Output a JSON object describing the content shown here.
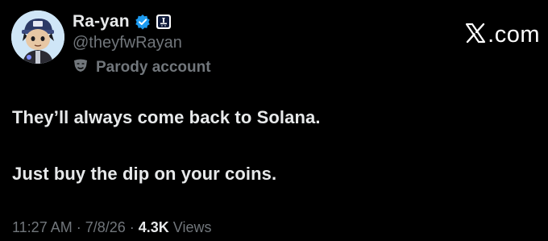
{
  "author": {
    "display_name": "Ra-yan",
    "handle": "@theyfwRayan",
    "parody_label": "Parody account",
    "verified_color": "#1d9bf0"
  },
  "site": {
    "logo_text": ".com"
  },
  "post": {
    "line_1": "They’ll always come back to Solana.",
    "line_2": "Just buy the dip on your coins."
  },
  "meta": {
    "time": "11:27 AM",
    "sep_1": "·",
    "date": "7/8/26",
    "sep_2": "·",
    "views_count": "4.3K",
    "views_label": "Views"
  },
  "icons": {
    "avatar": "avatar",
    "verified": "verified-badge-icon",
    "affiliate": "affiliate-badge-icon",
    "parody": "mask-icon",
    "logo": "x-logo-icon"
  }
}
